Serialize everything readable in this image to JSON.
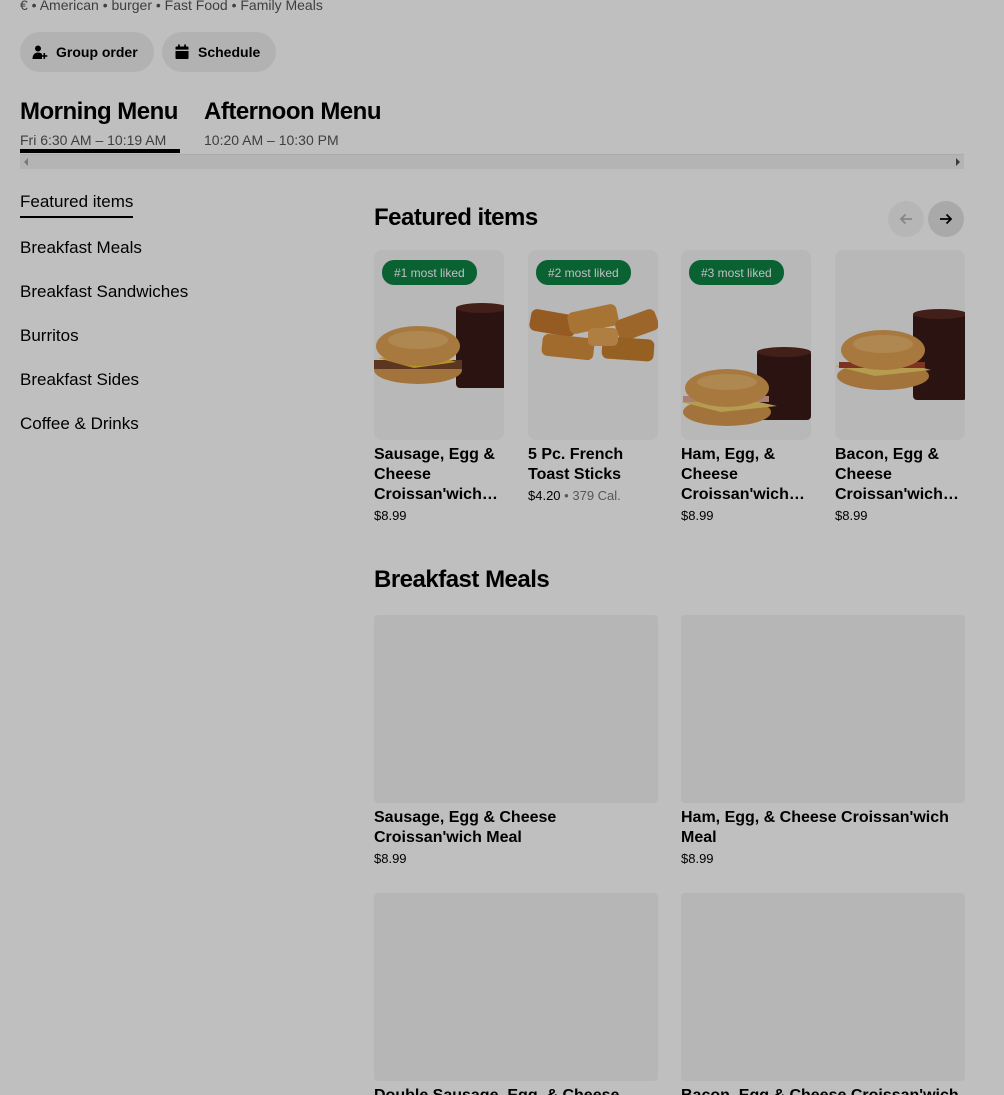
{
  "store": {
    "cuisine_line": "€ • American • burger • Fast Food • Family Meals"
  },
  "actions": {
    "group_order": "Group order",
    "schedule": "Schedule"
  },
  "menus": [
    {
      "title": "Morning Menu",
      "hours": "Fri 6:30 AM – 10:19 AM",
      "selected": true
    },
    {
      "title": "Afternoon Menu",
      "hours": "10:20 AM – 10:30 PM",
      "selected": false
    }
  ],
  "categories": [
    {
      "label": "Featured items",
      "active": true
    },
    {
      "label": "Breakfast Meals",
      "active": false
    },
    {
      "label": "Breakfast Sandwiches",
      "active": false
    },
    {
      "label": "Burritos",
      "active": false
    },
    {
      "label": "Breakfast Sides",
      "active": false
    },
    {
      "label": "Coffee & Drinks",
      "active": false
    }
  ],
  "featured": {
    "title": "Featured items",
    "items": [
      {
        "badge": "#1 most liked",
        "name": "Sausage, Egg & Cheese Croissan'wich Meal",
        "price": "$8.99",
        "calories": "",
        "image": "croissant-sandwich-with-coffee"
      },
      {
        "badge": "#2 most liked",
        "name": "5 Pc. French Toast Sticks",
        "price": "$4.20",
        "calories": "379 Cal.",
        "separator": "•",
        "image": "french-toast-sticks"
      },
      {
        "badge": "#3 most liked",
        "name": "Ham, Egg, & Cheese Croissan'wich Meal",
        "price": "$8.99",
        "calories": "",
        "image": "croissant-sandwich-with-coffee"
      },
      {
        "badge": "",
        "name": "Bacon, Egg & Cheese Croissan'wich Meal",
        "price": "$8.99",
        "calories": "",
        "image": "croissant-sandwich-with-coffee"
      }
    ]
  },
  "breakfast_meals": {
    "title": "Breakfast Meals",
    "items": [
      {
        "name": "Sausage, Egg & Cheese Croissan'wich Meal",
        "price": "$8.99"
      },
      {
        "name": "Ham, Egg, & Cheese Croissan'wich Meal",
        "price": "$8.99"
      },
      {
        "name": "Double Sausage, Egg, & Cheese",
        "price": ""
      },
      {
        "name": "Bacon, Egg & Cheese Croissan'wich",
        "price": ""
      }
    ]
  },
  "colors": {
    "badge_green": "#0e8345",
    "pill_bg": "#eeeeee",
    "modal_dim": "rgba(0,0,0,0.25)"
  }
}
